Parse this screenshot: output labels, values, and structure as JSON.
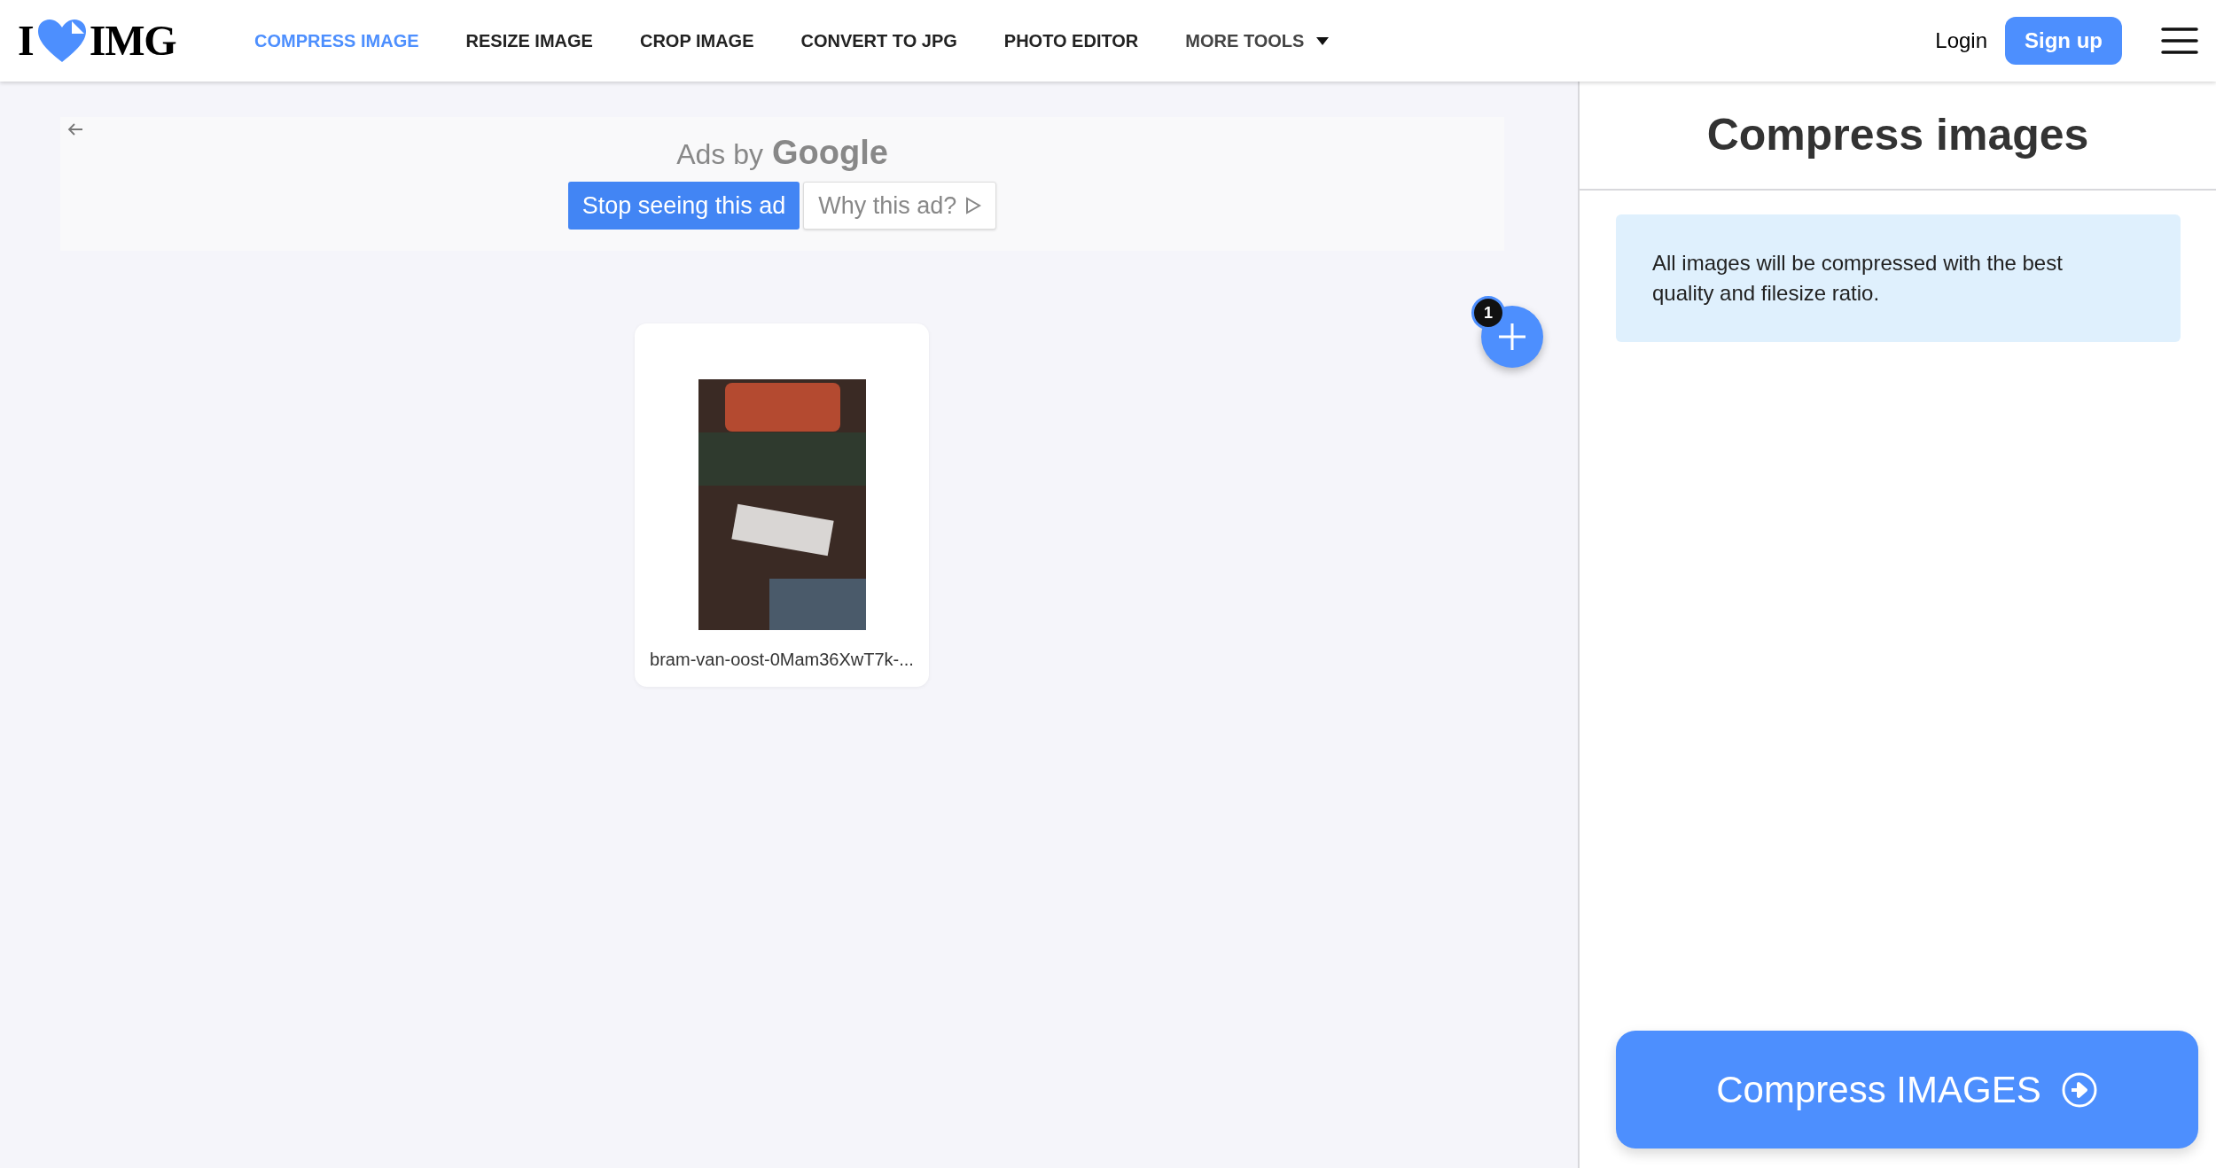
{
  "header": {
    "logo": {
      "left": "I",
      "right": "IMG"
    },
    "nav": [
      {
        "label": "COMPRESS IMAGE",
        "selected": true,
        "has_menu": false
      },
      {
        "label": "RESIZE IMAGE",
        "selected": false,
        "has_menu": false
      },
      {
        "label": "CROP IMAGE",
        "selected": false,
        "has_menu": false
      },
      {
        "label": "CONVERT TO JPG",
        "selected": false,
        "has_menu": false
      },
      {
        "label": "PHOTO EDITOR",
        "selected": false,
        "has_menu": false
      },
      {
        "label": "MORE TOOLS",
        "selected": false,
        "has_menu": true
      }
    ],
    "login": "Login",
    "signup": "Sign up"
  },
  "ad": {
    "label": "Ads by",
    "brand": "Google",
    "stop_button": "Stop seeing this ad",
    "why_button": "Why this ad?"
  },
  "files": [
    {
      "name": "bram-van-oost-0Mam36XwT7k-..."
    }
  ],
  "add_button": {
    "count": "1"
  },
  "panel": {
    "title": "Compress images",
    "info": "All images will be compressed with the best quality and filesize ratio.",
    "action": "Compress IMAGES"
  }
}
